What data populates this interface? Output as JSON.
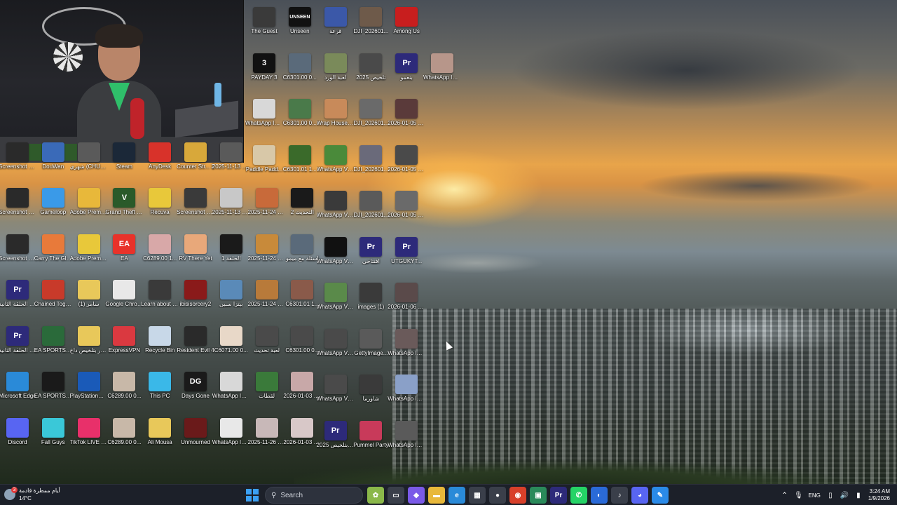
{
  "desktop": {
    "icons": [
      {
        "label": "The Guest",
        "glyph": "",
        "color": "#3a3a3a",
        "col": 0,
        "row": 0,
        "block": "right"
      },
      {
        "label": "Unseen",
        "glyph": "UNSEEN",
        "color": "#111111",
        "col": 1,
        "row": 0,
        "block": "right"
      },
      {
        "label": "قرعة",
        "glyph": "",
        "color": "#3b58a8",
        "col": 2,
        "row": 0,
        "block": "right"
      },
      {
        "label": "DJI_202601...",
        "glyph": "",
        "color": "#6e5a4a",
        "col": 3,
        "row": 0,
        "block": "right"
      },
      {
        "label": "Among Us",
        "glyph": "",
        "color": "#c81e1e",
        "col": 4,
        "row": 0,
        "block": "right"
      },
      {
        "label": "PAYDAY 3",
        "glyph": "3",
        "color": "#111111",
        "col": 0,
        "row": 1,
        "block": "right"
      },
      {
        "label": "C6301.00 0...",
        "glyph": "",
        "color": "#5a6a7a",
        "col": 1,
        "row": 1,
        "block": "right"
      },
      {
        "label": "لعبة الورد",
        "glyph": "",
        "color": "#7a8a5a",
        "col": 2,
        "row": 1,
        "block": "right"
      },
      {
        "label": "2025 تلخيص",
        "glyph": "",
        "color": "#4a4a4a",
        "col": 3,
        "row": 1,
        "block": "right"
      },
      {
        "label": "بنعمو",
        "glyph": "Pr",
        "color": "#2d2a7a",
        "col": 4,
        "row": 1,
        "block": "right"
      },
      {
        "label": "WhatsApp Image 2026...",
        "glyph": "",
        "color": "#b7968a",
        "col": 5,
        "row": 1,
        "block": "right"
      },
      {
        "label": "WhatsApp Image 2025...",
        "glyph": "",
        "color": "#d8d8d8",
        "col": 0,
        "row": 2,
        "block": "right"
      },
      {
        "label": "C6301.00 0...",
        "glyph": "",
        "color": "#4a7a4a",
        "col": 1,
        "row": 2,
        "block": "right"
      },
      {
        "label": "Wrap House Simulator©",
        "glyph": "",
        "color": "#c88a5a",
        "col": 2,
        "row": 2,
        "block": "right"
      },
      {
        "label": "DJI_202601...",
        "glyph": "",
        "color": "#6a6a6a",
        "col": 3,
        "row": 2,
        "block": "right"
      },
      {
        "label": "2026-01-05 00-47-14.00...",
        "glyph": "",
        "color": "#5a3a3a",
        "col": 4,
        "row": 2,
        "block": "right"
      },
      {
        "label": "Paddle Padd...",
        "glyph": "",
        "color": "#d8c8a8",
        "col": 0,
        "row": 3,
        "block": "right"
      },
      {
        "label": "C6301.01 1...",
        "glyph": "",
        "color": "#3a6a2a",
        "col": 1,
        "row": 3,
        "block": "right"
      },
      {
        "label": "WhatsApp Video 2026...",
        "glyph": "",
        "color": "#4a8a3a",
        "col": 2,
        "row": 3,
        "block": "right"
      },
      {
        "label": "DJI_202601...",
        "glyph": "",
        "color": "#6a6a7a",
        "col": 3,
        "row": 3,
        "block": "right"
      },
      {
        "label": "2026-01-05 00-47-14.02...",
        "glyph": "",
        "color": "#4a4a4a",
        "col": 4,
        "row": 3,
        "block": "right"
      },
      {
        "label": "WhatsApp Video 2026...",
        "glyph": "",
        "color": "#3a3a3a",
        "col": 2,
        "row": 4,
        "block": "right"
      },
      {
        "label": "DJI_202601...",
        "glyph": "",
        "color": "#5a5a5a",
        "col": 3,
        "row": 4,
        "block": "right"
      },
      {
        "label": "2026-01-05 00-47-14.01...",
        "glyph": "",
        "color": "#6a6a6a",
        "col": 4,
        "row": 4,
        "block": "right"
      },
      {
        "label": "WhatsApp Video 2026...",
        "glyph": "",
        "color": "#111111",
        "col": 2,
        "row": 5,
        "block": "right"
      },
      {
        "label": "افتتاحي",
        "glyph": "Pr",
        "color": "#2d2a7a",
        "col": 3,
        "row": 5,
        "block": "right"
      },
      {
        "label": "UTGUKYT...",
        "glyph": "Pr",
        "color": "#2d2a7a",
        "col": 4,
        "row": 5,
        "block": "right"
      },
      {
        "label": "WhatsApp Video 2026...",
        "glyph": "",
        "color": "#5a8a4a",
        "col": 2,
        "row": 6,
        "block": "right"
      },
      {
        "label": "images (1)",
        "glyph": "",
        "color": "#3a3a3a",
        "col": 3,
        "row": 6,
        "block": "right"
      },
      {
        "label": "2026-01-06 23-02-47.00...",
        "glyph": "",
        "color": "#5a4a4a",
        "col": 4,
        "row": 6,
        "block": "right"
      },
      {
        "label": "WhatsApp Video 2026...",
        "glyph": "",
        "color": "#4a4a4a",
        "col": 2,
        "row": 7,
        "block": "right"
      },
      {
        "label": "GettyImage...",
        "glyph": "",
        "color": "#5a5a5a",
        "col": 3,
        "row": 7,
        "block": "right"
      },
      {
        "label": "WhatsApp Image 2026...",
        "glyph": "",
        "color": "#6a5a5a",
        "col": 4,
        "row": 7,
        "block": "right"
      },
      {
        "label": "WhatsApp Video 2026...",
        "glyph": "",
        "color": "#4a4a4a",
        "col": 2,
        "row": 8,
        "block": "right"
      },
      {
        "label": "شاورما",
        "glyph": "",
        "color": "#3a3a3a",
        "col": 3,
        "row": 8,
        "block": "right"
      },
      {
        "label": "WhatsApp Image 2026...",
        "glyph": "",
        "color": "#8aa0c8",
        "col": 4,
        "row": 8,
        "block": "right"
      },
      {
        "label": "انطال الدار بتلخيص 2025",
        "glyph": "Pr",
        "color": "#2d2a7a",
        "col": 2,
        "row": 9,
        "block": "right"
      },
      {
        "label": "Pummel Party",
        "glyph": "",
        "color": "#c83a5a",
        "col": 3,
        "row": 9,
        "block": "right"
      },
      {
        "label": "WhatsApp Image 2026...",
        "glyph": "",
        "color": "#5a5a5a",
        "col": 4,
        "row": 9,
        "block": "right"
      },
      {
        "label": "Screenshot 2025-10-...",
        "glyph": "",
        "color": "#2a2a2a",
        "col": 0,
        "row": 3,
        "block": "left"
      },
      {
        "label": "DouWan",
        "glyph": "",
        "color": "#3a6ab8",
        "col": 1,
        "row": 3,
        "block": "left"
      },
      {
        "label": "شهري (CHUXIE)",
        "glyph": "",
        "color": "#5a5a5a",
        "col": 2,
        "row": 3,
        "block": "left"
      },
      {
        "label": "Steam",
        "glyph": "",
        "color": "#1b2838",
        "col": 3,
        "row": 3,
        "block": "left"
      },
      {
        "label": "AnyDesk",
        "glyph": "",
        "color": "#d8322a",
        "col": 4,
        "row": 3,
        "block": "left"
      },
      {
        "label": "Counter Str... 2",
        "glyph": "",
        "color": "#d8a83a",
        "col": 5,
        "row": 3,
        "block": "left"
      },
      {
        "label": "2025-11-13 20-50-14.00...",
        "glyph": "",
        "color": "#5a5a5a",
        "col": 6,
        "row": 3,
        "block": "left"
      },
      {
        "label": "Screenshot 2025-10-...",
        "glyph": "",
        "color": "#2a2a2a",
        "col": 0,
        "row": 4,
        "block": "left"
      },
      {
        "label": "Gameloop",
        "glyph": "",
        "color": "#3a9ae8",
        "col": 1,
        "row": 4,
        "block": "left"
      },
      {
        "label": "Adobe Premiere P...",
        "glyph": "",
        "color": "#e8b83a",
        "col": 2,
        "row": 4,
        "block": "left"
      },
      {
        "label": "Grand Theft Auto V",
        "glyph": "V",
        "color": "#2a5a2a",
        "col": 3,
        "row": 4,
        "block": "left"
      },
      {
        "label": "Recuva",
        "glyph": "",
        "color": "#e8c83a",
        "col": 4,
        "row": 4,
        "block": "left"
      },
      {
        "label": "Screenshot 2025-11-...",
        "glyph": "",
        "color": "#3a3a3a",
        "col": 5,
        "row": 4,
        "block": "left"
      },
      {
        "label": "2025-11-13 20-50-14.00...",
        "glyph": "",
        "color": "#c8c8c8",
        "col": 6,
        "row": 4,
        "block": "left"
      },
      {
        "label": "2025-11-24 03-24-12.00...",
        "glyph": "",
        "color": "#c86a3a",
        "col": 7,
        "row": 4,
        "block": "left"
      },
      {
        "label": "التحديث 2",
        "glyph": "",
        "color": "#1a1a1a",
        "col": 8,
        "row": 4,
        "block": "left"
      },
      {
        "label": "Screenshot 2025-10-...",
        "glyph": "",
        "color": "#2a2a2a",
        "col": 0,
        "row": 5,
        "block": "left"
      },
      {
        "label": "Carry The Glass",
        "glyph": "",
        "color": "#e87a3a",
        "col": 1,
        "row": 5,
        "block": "left"
      },
      {
        "label": "Adobe Premiere P...",
        "glyph": "",
        "color": "#e8c83a",
        "col": 2,
        "row": 5,
        "block": "left"
      },
      {
        "label": "EA",
        "glyph": "EA",
        "color": "#e8322a",
        "col": 3,
        "row": 5,
        "block": "left"
      },
      {
        "label": "C6289.00 1...",
        "glyph": "",
        "color": "#d8a8a8",
        "col": 4,
        "row": 5,
        "block": "left"
      },
      {
        "label": "RV There Yet",
        "glyph": "",
        "color": "#e8a87a",
        "col": 5,
        "row": 5,
        "block": "left"
      },
      {
        "label": "الحلقة 1",
        "glyph": "",
        "color": "#1a1a1a",
        "col": 6,
        "row": 5,
        "block": "left"
      },
      {
        "label": "2025-11-24 03-24-12.00...",
        "glyph": "",
        "color": "#c88a3a",
        "col": 7,
        "row": 5,
        "block": "left"
      },
      {
        "label": "اسئلة مع ميمو",
        "glyph": "",
        "color": "#5a6a7a",
        "col": 8,
        "row": 5,
        "block": "left"
      },
      {
        "label": "لعبة الخيار الحلقة الثانية",
        "glyph": "Pr",
        "color": "#2d2a7a",
        "col": 0,
        "row": 6,
        "block": "left"
      },
      {
        "label": "Chained Together",
        "glyph": "",
        "color": "#c83a2a",
        "col": 1,
        "row": 6,
        "block": "left"
      },
      {
        "label": "(1) سامر",
        "glyph": "",
        "color": "#e8c85a",
        "col": 2,
        "row": 6,
        "block": "left"
      },
      {
        "label": "Google Chrome",
        "glyph": "",
        "color": "#e8e8e8",
        "col": 3,
        "row": 6,
        "block": "left"
      },
      {
        "label": "Learn about this picture",
        "glyph": "",
        "color": "#3a3a3a",
        "col": 4,
        "row": 6,
        "block": "left"
      },
      {
        "label": "ibisisorcery2",
        "glyph": "",
        "color": "#8a1a1a",
        "col": 5,
        "row": 6,
        "block": "left"
      },
      {
        "label": "بيتزا سبين",
        "glyph": "",
        "color": "#5a8ab8",
        "col": 6,
        "row": 6,
        "block": "left"
      },
      {
        "label": "2025-11-24 03-24-12.00...",
        "glyph": "",
        "color": "#b87a3a",
        "col": 7,
        "row": 6,
        "block": "left"
      },
      {
        "label": "C6301.01 1...",
        "glyph": "",
        "color": "#8a5a4a",
        "col": 8,
        "row": 6,
        "block": "left"
      },
      {
        "label": "لعبة الخيار الحلقة الثانية",
        "glyph": "Pr",
        "color": "#2d2a7a",
        "col": 0,
        "row": 7,
        "block": "left"
      },
      {
        "label": "EA SPORTS FC™ 25",
        "glyph": "",
        "color": "#2a6a3a",
        "col": 1,
        "row": 7,
        "block": "left"
      },
      {
        "label": "انطال الدار بتلخيص داخ",
        "glyph": "",
        "color": "#e8c85a",
        "col": 2,
        "row": 7,
        "block": "left"
      },
      {
        "label": "ExpressVPN",
        "glyph": "",
        "color": "#da3940",
        "col": 3,
        "row": 7,
        "block": "left"
      },
      {
        "label": "Recycle Bin",
        "glyph": "",
        "color": "#c8d8e8",
        "col": 4,
        "row": 7,
        "block": "left"
      },
      {
        "label": "Resident Evil 4",
        "glyph": "",
        "color": "#2a2a2a",
        "col": 5,
        "row": 7,
        "block": "left"
      },
      {
        "label": "C6071.00 0...",
        "glyph": "",
        "color": "#e8d8c8",
        "col": 6,
        "row": 7,
        "block": "left"
      },
      {
        "label": "لعبة تحديث",
        "glyph": "",
        "color": "#4a4a4a",
        "col": 7,
        "row": 7,
        "block": "left"
      },
      {
        "label": "C6301.00 0...",
        "glyph": "",
        "color": "#4a4a4a",
        "col": 8,
        "row": 7,
        "block": "left"
      },
      {
        "label": "Microsoft Edge",
        "glyph": "",
        "color": "#2a8ad8",
        "col": 0,
        "row": 8,
        "block": "left"
      },
      {
        "label": "EA SPORTS FC™ 26",
        "glyph": "",
        "color": "#1a1a1a",
        "col": 1,
        "row": 8,
        "block": "left"
      },
      {
        "label": "PlayStation® Accessories",
        "glyph": "",
        "color": "#1a5ab8",
        "col": 2,
        "row": 8,
        "block": "left"
      },
      {
        "label": "C6289.00 0...",
        "glyph": "",
        "color": "#c8b8a8",
        "col": 3,
        "row": 8,
        "block": "left"
      },
      {
        "label": "This PC",
        "glyph": "",
        "color": "#3ab8e8",
        "col": 4,
        "row": 8,
        "block": "left"
      },
      {
        "label": "Days Gone",
        "glyph": "DG",
        "color": "#1a1a1a",
        "col": 5,
        "row": 8,
        "block": "left"
      },
      {
        "label": "WhatsApp Image 2025...",
        "glyph": "",
        "color": "#d8d8d8",
        "col": 6,
        "row": 8,
        "block": "left"
      },
      {
        "label": "لقطات",
        "glyph": "",
        "color": "#3a7a3a",
        "col": 7,
        "row": 8,
        "block": "left"
      },
      {
        "label": "2026-01-03 22-10-12.00...",
        "glyph": "",
        "color": "#c8a8a8",
        "col": 8,
        "row": 8,
        "block": "left"
      },
      {
        "label": "Discord",
        "glyph": "",
        "color": "#5865f2",
        "col": 0,
        "row": 9,
        "block": "left"
      },
      {
        "label": "Fall Guys",
        "glyph": "",
        "color": "#3ac8d8",
        "col": 1,
        "row": 9,
        "block": "left"
      },
      {
        "label": "TikTok LIVE Studio",
        "glyph": "",
        "color": "#e8306a",
        "col": 2,
        "row": 9,
        "block": "left"
      },
      {
        "label": "C6289.00 0...",
        "glyph": "",
        "color": "#c8b8a8",
        "col": 3,
        "row": 9,
        "block": "left"
      },
      {
        "label": "Ali Mousa",
        "glyph": "",
        "color": "#e8c85a",
        "col": 4,
        "row": 9,
        "block": "left"
      },
      {
        "label": "Unmourned",
        "glyph": "",
        "color": "#6a1a1a",
        "col": 5,
        "row": 9,
        "block": "left"
      },
      {
        "label": "WhatsApp Image 2025...",
        "glyph": "",
        "color": "#e8e8e8",
        "col": 6,
        "row": 9,
        "block": "left"
      },
      {
        "label": "2025-11-26 00-55-28.00...",
        "glyph": "",
        "color": "#c8b8b8",
        "col": 7,
        "row": 9,
        "block": "left"
      },
      {
        "label": "2026-01-03 22-10-12.00...",
        "glyph": "",
        "color": "#d8c8c8",
        "col": 8,
        "row": 9,
        "block": "left"
      }
    ]
  },
  "taskbar": {
    "weather": {
      "text": "أيام ممطرة قادمة",
      "temp": "14°C",
      "badge": "3"
    },
    "search_label": "Search",
    "apps": [
      {
        "name": "widgets-icon",
        "glyph": "✿",
        "color": "#8bb84a"
      },
      {
        "name": "task-view-icon",
        "glyph": "▭",
        "color": "#3a3f4a"
      },
      {
        "name": "copilot-icon",
        "glyph": "◆",
        "color": "#7a5ae8"
      },
      {
        "name": "file-explorer-icon",
        "glyph": "▬",
        "color": "#e8b83a"
      },
      {
        "name": "edge-icon",
        "glyph": "e",
        "color": "#2a8ad8"
      },
      {
        "name": "store-icon",
        "glyph": "▦",
        "color": "#3a3f4a"
      },
      {
        "name": "location-icon",
        "glyph": "●",
        "color": "#3a3f4a"
      },
      {
        "name": "chrome-icon",
        "glyph": "◉",
        "color": "#d8402a"
      },
      {
        "name": "obs-icon",
        "glyph": "▣",
        "color": "#2a8a5a"
      },
      {
        "name": "premiere-icon",
        "glyph": "Pr",
        "color": "#2d2a7a"
      },
      {
        "name": "whatsapp-icon",
        "glyph": "✆",
        "color": "#25d366"
      },
      {
        "name": "browser-icon",
        "glyph": "◐",
        "color": "#2a6ad8"
      },
      {
        "name": "music-icon",
        "glyph": "♪",
        "color": "#3a3f4a"
      },
      {
        "name": "discord-icon",
        "glyph": "◕",
        "color": "#5865f2"
      },
      {
        "name": "paint-icon",
        "glyph": "✎",
        "color": "#2a8ae8"
      }
    ],
    "language": "ENG",
    "time": "3:24 AM",
    "date": "1/9/2026"
  }
}
